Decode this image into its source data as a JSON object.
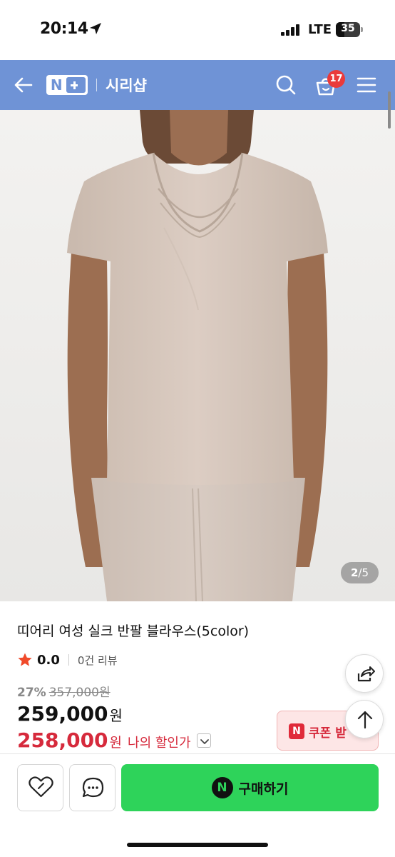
{
  "status_bar": {
    "time": "20:14",
    "network": "LTE",
    "battery": "35"
  },
  "header": {
    "shop_name": "시리샵",
    "cart_count": "17"
  },
  "gallery": {
    "current": "2",
    "total": "/5"
  },
  "product": {
    "title": "띠어리 여성 실크 반팔 블라우스(5color)",
    "rating": "0.0",
    "review_count": "0건 리뷰",
    "discount_pct": "27%",
    "original_price": "357,000원",
    "price": "259,000",
    "price_unit": "원",
    "my_price": "258,000",
    "my_price_unit": "원",
    "my_price_label": "나의 할인가"
  },
  "coupon": {
    "label": "쿠폰 받"
  },
  "actions": {
    "buy_label": "구매하기"
  },
  "colors": {
    "header": "#6f93d6",
    "buy": "#2ed35a",
    "sale": "#d62a3c"
  }
}
